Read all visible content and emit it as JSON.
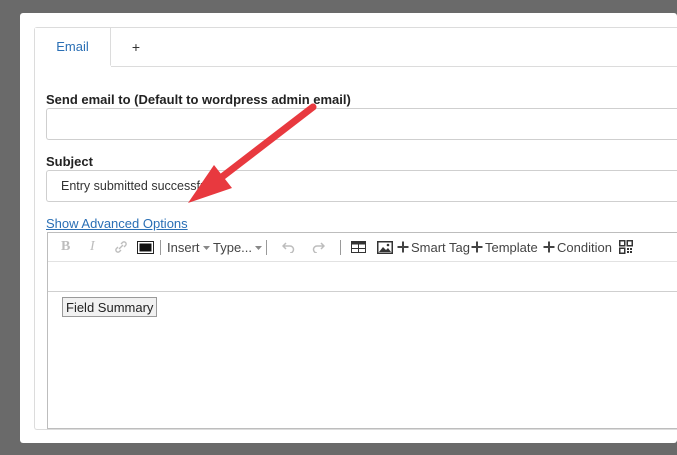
{
  "tabs": {
    "active": "Email",
    "add": "+"
  },
  "fields": {
    "send_to": {
      "label": "Send email to (Default to wordpress admin email)",
      "value": ""
    },
    "subject": {
      "label": "Subject",
      "value": "Entry submitted successfully"
    }
  },
  "advanced_link": "Show Advanced Options",
  "toolbar": {
    "bold": "B",
    "italic": "I",
    "insert": "Insert",
    "type": "Type...",
    "smart_tag": "Smart Tag",
    "template": "Template",
    "condition": "Condition"
  },
  "editor": {
    "chip": "Field Summary"
  },
  "annotation": {
    "arrow_color": "#e8393f"
  }
}
